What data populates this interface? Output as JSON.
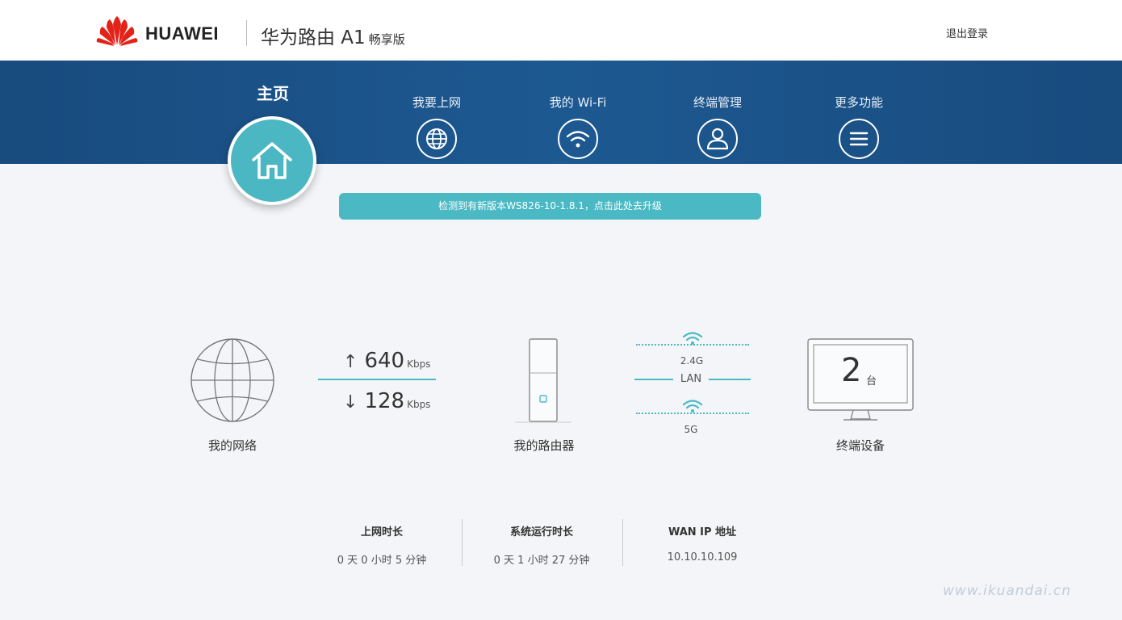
{
  "header": {
    "brand": "HUAWEI",
    "product": "华为路由 A1",
    "edition": "畅享版",
    "logout_label": "退出登录"
  },
  "nav": {
    "home_label": "主页",
    "items": [
      {
        "label": "我要上网",
        "icon": "globe-icon"
      },
      {
        "label": "我的 Wi-Fi",
        "icon": "wifi-icon"
      },
      {
        "label": "终端管理",
        "icon": "user-icon"
      },
      {
        "label": "更多功能",
        "icon": "menu-icon"
      }
    ]
  },
  "update_banner": "检测到有新版本WS826-10-1.8.1，点击此处去升级",
  "status": {
    "network_label": "我的网络",
    "upload_value": "640",
    "upload_unit": "Kbps",
    "download_value": "128",
    "download_unit": "Kbps",
    "router_label": "我的路由器",
    "band_24": "2.4G",
    "band_lan": "LAN",
    "band_5": "5G",
    "devices_count": "2",
    "devices_unit": "台",
    "devices_label": "终端设备"
  },
  "info": [
    {
      "title": "上网时长",
      "value": "0 天 0 小时 5 分钟"
    },
    {
      "title": "系统运行时长",
      "value": "0 天 1 小时 27 分钟"
    },
    {
      "title": "WAN IP 地址",
      "value": "10.10.10.109"
    }
  ],
  "watermark": "www.ikuandai.cn",
  "colors": {
    "nav_bg": "#1d5991",
    "accent": "#4ab9c4",
    "brand_red": "#e2231a"
  }
}
